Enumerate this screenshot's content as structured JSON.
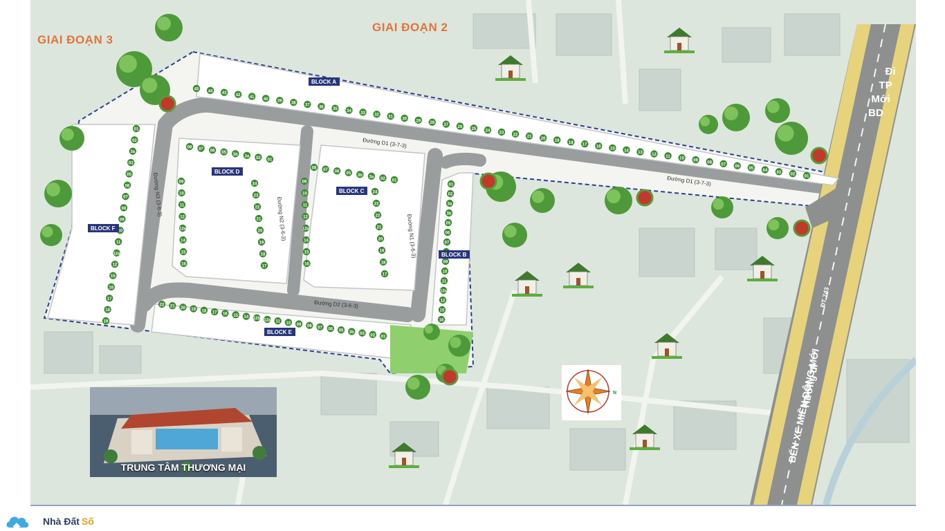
{
  "map": {
    "phases": [
      "GIAI ĐOẠN 3",
      "GIAI ĐOẠN 2"
    ],
    "blocks": [
      "BLOCK A",
      "BLOCK B",
      "BLOCK C",
      "BLOCK D",
      "BLOCK E",
      "BLOCK F"
    ],
    "roads": {
      "d1_a": "Đường D1 (3-7-3)",
      "d1_b": "Đường D1 (3-7-3)",
      "d2": "Đường D2 (3-6-3)",
      "n1": "Đường N1 (3-6-3)",
      "n2": "Đường N2 (3-6-3)",
      "n3": "Đường N3 (3-6-3)",
      "dt743": "ĐT 743"
    },
    "directions": {
      "north_line1": "Đi",
      "north_line2": "TP",
      "north_line3": "Mới",
      "north_line4": "BD",
      "south_line1": "Hướng đi",
      "south_line2": "BẾN XE MIỀN ĐÔNG MỚI"
    },
    "compass_n": "N",
    "block_a_lots": [
      "45",
      "44",
      "43",
      "42",
      "41",
      "40",
      "39",
      "38",
      "37",
      "36",
      "35",
      "34",
      "33",
      "32",
      "31",
      "30",
      "29",
      "28",
      "27",
      "26",
      "25",
      "24",
      "23",
      "22",
      "21",
      "20",
      "19",
      "18",
      "17",
      "16",
      "15",
      "14",
      "13",
      "12",
      "11",
      "10",
      "09",
      "08",
      "07",
      "06",
      "05",
      "04",
      "03",
      "02",
      "01"
    ],
    "block_f_lots": [
      "01",
      "02",
      "3a",
      "03",
      "05",
      "06",
      "07",
      "08",
      "09",
      "10",
      "11",
      "12a",
      "12",
      "15",
      "16",
      "17",
      "18",
      "19"
    ],
    "block_e_lots": [
      "22",
      "21",
      "20",
      "19",
      "18",
      "17",
      "16",
      "15",
      "14",
      "12b",
      "12a",
      "11",
      "10",
      "09",
      "08",
      "07",
      "06",
      "05",
      "3b",
      "03",
      "02",
      "01"
    ],
    "block_b_lots": [
      "01",
      "02",
      "3a",
      "3b",
      "05",
      "06",
      "07",
      "08",
      "09",
      "10",
      "11",
      "12a",
      "12",
      "15",
      "16"
    ],
    "block_d_top": [
      "08",
      "07",
      "06",
      "05",
      "3b",
      "3a",
      "02",
      "01"
    ],
    "block_c_top": [
      "08",
      "07",
      "06",
      "05",
      "3b",
      "3a",
      "02",
      "01"
    ],
    "inner_lots": [
      "09",
      "10",
      "11",
      "12",
      "12a",
      "14",
      "15",
      "16",
      "17",
      "18",
      "19",
      "20",
      "21",
      "22",
      "23",
      "24"
    ],
    "caption": "TRUNG TÂM THƯƠNG MẠI",
    "brand_main": "Nhà Đất",
    "brand_accent": "Số"
  }
}
